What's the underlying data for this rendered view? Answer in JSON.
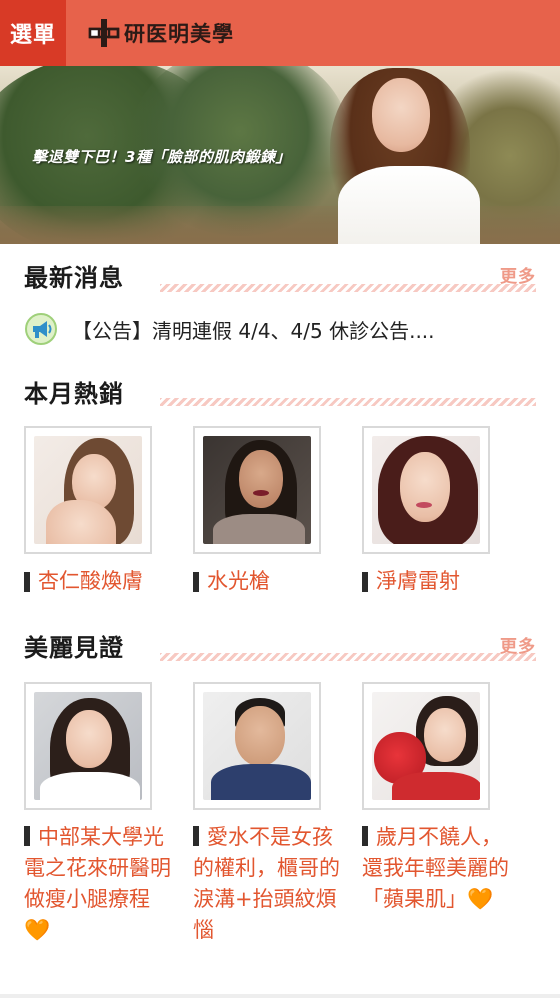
{
  "header": {
    "menu_label": "選單",
    "brand_name": "研医明美學",
    "background": "#e7624b",
    "menu_background": "#d83a26"
  },
  "banner": {
    "caption": "擊退雙下巴！3種「臉部的肌肉鍛鍊」"
  },
  "news": {
    "title": "最新消息",
    "more_label": "更多",
    "items": [
      {
        "icon": "megaphone-icon",
        "text": "【公告】清明連假 4/4、4/5 休診公告...."
      }
    ]
  },
  "hot": {
    "title": "本月熱銷",
    "items": [
      {
        "label": "杏仁酸煥膚"
      },
      {
        "label": "水光槍"
      },
      {
        "label": "淨膚雷射"
      }
    ]
  },
  "testimonials": {
    "title": "美麗見證",
    "more_label": "更多",
    "items": [
      {
        "label": "中部某大學光電之花來研醫明做瘦小腿療程🧡"
      },
      {
        "label": "愛水不是女孩的權利，櫃哥的淚溝+抬頭紋煩惱"
      },
      {
        "label": "歲月不饒人，還我年輕美麗的「蘋果肌」🧡"
      }
    ]
  },
  "colors": {
    "accent": "#e2562f",
    "more": "#ef9a88",
    "stripe": "#f7c9c2"
  }
}
